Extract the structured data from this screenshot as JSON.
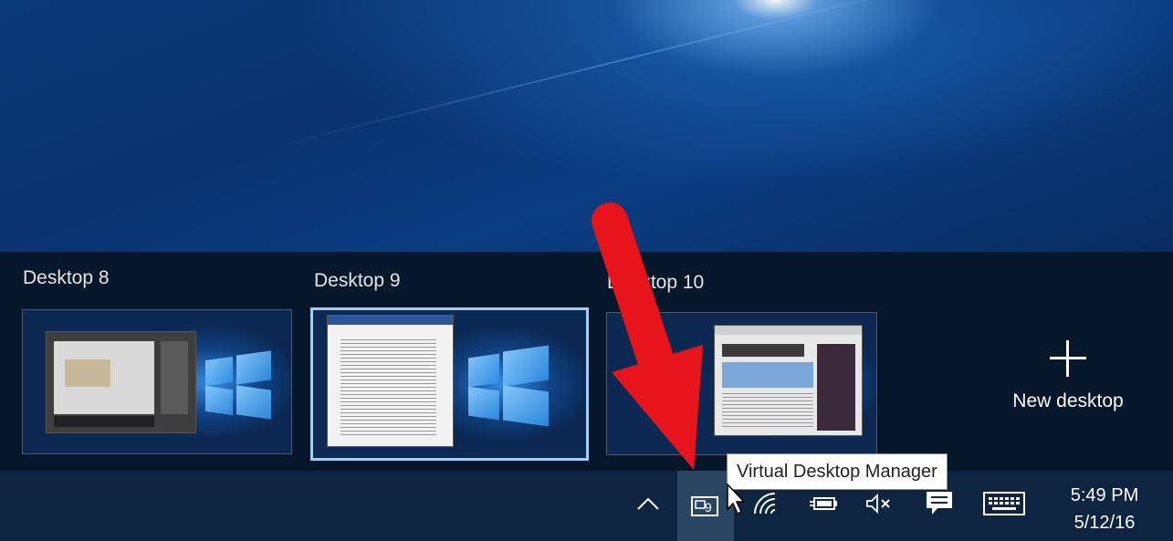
{
  "desktops": [
    {
      "label": "Desktop 8",
      "active": false
    },
    {
      "label": "Desktop 9",
      "active": true
    },
    {
      "label": "Desktop 10",
      "active": false
    }
  ],
  "new_desktop": {
    "icon": "plus-icon",
    "label": "New desktop"
  },
  "tooltip": "Virtual Desktop Manager",
  "tray": {
    "items": [
      {
        "name": "show-hidden-icons-chevron-icon"
      },
      {
        "name": "virtual-desktop-manager-icon",
        "badge": "9"
      },
      {
        "name": "wifi-icon"
      },
      {
        "name": "battery-power-icon"
      },
      {
        "name": "volume-muted-icon"
      },
      {
        "name": "action-center-icon"
      },
      {
        "name": "touch-keyboard-icon"
      }
    ],
    "time": "5:49 PM",
    "date": "5/12/16"
  },
  "colors": {
    "taskbar": "#0d2540",
    "active_border": "#a4cdf0",
    "arrow": "#e8141b"
  }
}
